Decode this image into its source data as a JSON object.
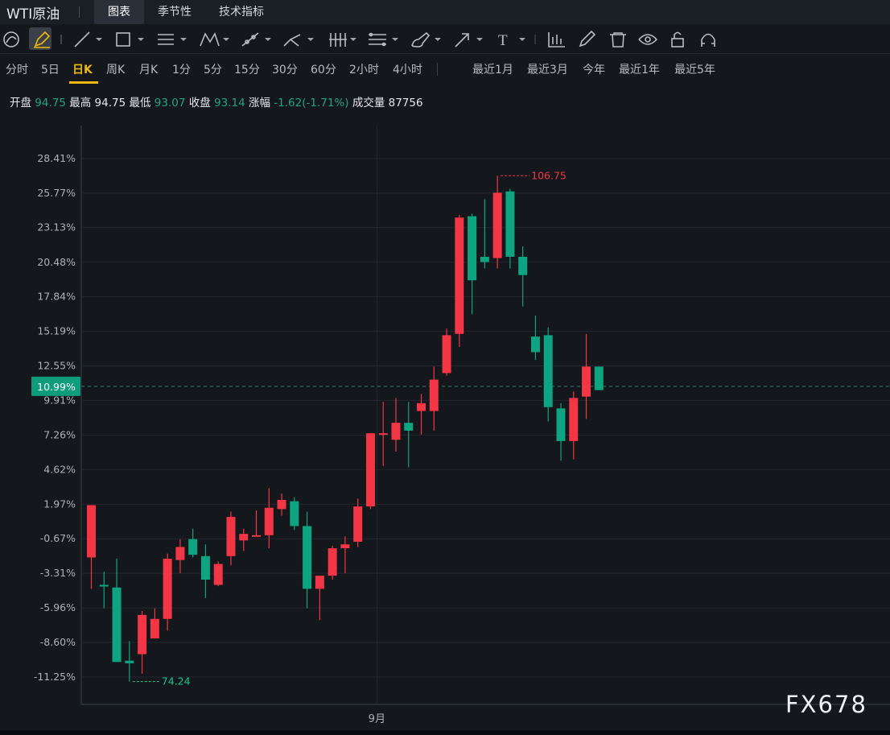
{
  "header": {
    "symbol": "WTI原油",
    "tabs": [
      {
        "label": "图表",
        "active": true
      },
      {
        "label": "季节性",
        "active": false
      },
      {
        "label": "技术指标",
        "active": false
      }
    ]
  },
  "toolbar": {
    "icons": [
      "magnet-icon",
      "pencil-icon",
      "line-tool-icon",
      "rectangle-tool-icon",
      "horizontal-lines-icon",
      "pattern-icon",
      "ray-icon",
      "fork-icon",
      "vertical-lines-icon",
      "fib-icon",
      "brush-icon",
      "arrow-icon",
      "text-icon",
      "measure-icon",
      "edit-icon",
      "trash-icon",
      "eye-icon",
      "unlock-icon",
      "magnet-u-icon"
    ],
    "text_tool": "T"
  },
  "periods": {
    "items": [
      "分时",
      "5日",
      "日K",
      "周K",
      "月K",
      "1分",
      "5分",
      "15分",
      "30分",
      "60分",
      "2小时",
      "4小时"
    ],
    "active": "日K",
    "ranges": [
      "最近1月",
      "最近3月",
      "今年",
      "最近1年",
      "最近5年"
    ]
  },
  "ohlc": {
    "open_label": "开盘",
    "open": "94.75",
    "high_label": "最高",
    "high": "94.75",
    "low_label": "最低",
    "low": "93.07",
    "close_label": "收盘",
    "close": "93.14",
    "change_label": "涨幅",
    "change": "-1.62(-1.71%)",
    "volume_label": "成交量",
    "volume": "87756"
  },
  "chart_data": {
    "type": "candlestick",
    "y_axis_ticks": [
      "28.41%",
      "25.77%",
      "23.13%",
      "20.48%",
      "17.84%",
      "15.19%",
      "12.55%",
      "9.91%",
      "7.26%",
      "4.62%",
      "1.97%",
      "-0.67%",
      "-3.31%",
      "-5.96%",
      "-8.60%",
      "-11.25%"
    ],
    "y_tick_values": [
      28.41,
      25.77,
      23.13,
      20.48,
      17.84,
      15.19,
      12.55,
      9.91,
      7.26,
      4.62,
      1.97,
      -0.67,
      -3.31,
      -5.96,
      -8.6,
      -11.25
    ],
    "ylim": [
      -13.0,
      30.0
    ],
    "x_label": "9月",
    "x_label_index": 22.5,
    "current_value_label": "10.99%",
    "current_value": 10.99,
    "high_marker": "106.75",
    "high_marker_index": 32,
    "low_marker": "74.24",
    "low_marker_index": 3,
    "colors": {
      "up": "#f23645",
      "down": "#0ea47f",
      "high_label": "#f23645",
      "low_label": "#22c38a",
      "current_badge": "#0f9c7c"
    },
    "candles": [
      {
        "o": -2.1,
        "h": 1.9,
        "l": -4.5,
        "c": 1.9
      },
      {
        "o": -4.2,
        "h": -3.2,
        "l": -6.0,
        "c": -4.3
      },
      {
        "o": -4.4,
        "h": -2.2,
        "l": -10.0,
        "c": -10.1
      },
      {
        "o": -10.0,
        "h": -8.5,
        "l": -11.6,
        "c": -10.2
      },
      {
        "o": -9.5,
        "h": -6.2,
        "l": -11.0,
        "c": -6.5
      },
      {
        "o": -8.3,
        "h": -6.0,
        "l": -8.3,
        "c": -6.8
      },
      {
        "o": -6.8,
        "h": -1.8,
        "l": -7.7,
        "c": -2.2
      },
      {
        "o": -2.3,
        "h": -0.7,
        "l": -3.3,
        "c": -1.3
      },
      {
        "o": -0.7,
        "h": 0.1,
        "l": -2.1,
        "c": -1.9
      },
      {
        "o": -2.0,
        "h": -1.1,
        "l": -5.2,
        "c": -3.8
      },
      {
        "o": -4.2,
        "h": -2.4,
        "l": -4.3,
        "c": -2.6
      },
      {
        "o": -2.0,
        "h": 1.4,
        "l": -2.7,
        "c": 1.0
      },
      {
        "o": -0.8,
        "h": 0.1,
        "l": -1.6,
        "c": -0.3
      },
      {
        "o": -0.4,
        "h": 1.5,
        "l": -0.5,
        "c": -0.4
      },
      {
        "o": -0.4,
        "h": 3.2,
        "l": -1.4,
        "c": 1.7
      },
      {
        "o": 1.6,
        "h": 2.8,
        "l": 1.1,
        "c": 2.3
      },
      {
        "o": 2.2,
        "h": 2.5,
        "l": 0.0,
        "c": 0.3
      },
      {
        "o": 0.3,
        "h": 1.4,
        "l": -6.0,
        "c": -4.5
      },
      {
        "o": -4.5,
        "h": -3.5,
        "l": -6.9,
        "c": -3.5
      },
      {
        "o": -3.5,
        "h": -1.2,
        "l": -3.8,
        "c": -1.4
      },
      {
        "o": -1.4,
        "h": -0.5,
        "l": -3.3,
        "c": -1.1
      },
      {
        "o": -0.9,
        "h": 2.4,
        "l": -1.3,
        "c": 1.8
      },
      {
        "o": 1.8,
        "h": 7.4,
        "l": 1.6,
        "c": 7.4
      },
      {
        "o": 7.4,
        "h": 9.8,
        "l": 4.9,
        "c": 7.4
      },
      {
        "o": 6.9,
        "h": 10.1,
        "l": 6.0,
        "c": 8.2
      },
      {
        "o": 8.2,
        "h": 9.8,
        "l": 4.8,
        "c": 7.6
      },
      {
        "o": 9.1,
        "h": 10.4,
        "l": 7.3,
        "c": 9.7
      },
      {
        "o": 9.1,
        "h": 12.5,
        "l": 7.6,
        "c": 11.5
      },
      {
        "o": 12.0,
        "h": 15.4,
        "l": 11.8,
        "c": 14.9
      },
      {
        "o": 15.0,
        "h": 24.1,
        "l": 14.0,
        "c": 23.9
      },
      {
        "o": 24.0,
        "h": 24.2,
        "l": 16.5,
        "c": 19.1
      },
      {
        "o": 20.9,
        "h": 25.3,
        "l": 20.0,
        "c": 20.5
      },
      {
        "o": 20.8,
        "h": 27.1,
        "l": 20.0,
        "c": 25.8
      },
      {
        "o": 25.9,
        "h": 26.1,
        "l": 20.0,
        "c": 20.9
      },
      {
        "o": 20.9,
        "h": 21.7,
        "l": 17.1,
        "c": 19.5
      },
      {
        "o": 14.8,
        "h": 16.4,
        "l": 13.0,
        "c": 13.6
      },
      {
        "o": 14.9,
        "h": 15.5,
        "l": 8.3,
        "c": 9.4
      },
      {
        "o": 9.3,
        "h": 9.7,
        "l": 5.3,
        "c": 6.8
      },
      {
        "o": 6.8,
        "h": 10.6,
        "l": 5.4,
        "c": 10.1
      },
      {
        "o": 10.2,
        "h": 15.0,
        "l": 8.5,
        "c": 12.5
      },
      {
        "o": 12.5,
        "h": 12.5,
        "l": 10.7,
        "c": 10.7
      }
    ]
  },
  "watermark": "FX678"
}
